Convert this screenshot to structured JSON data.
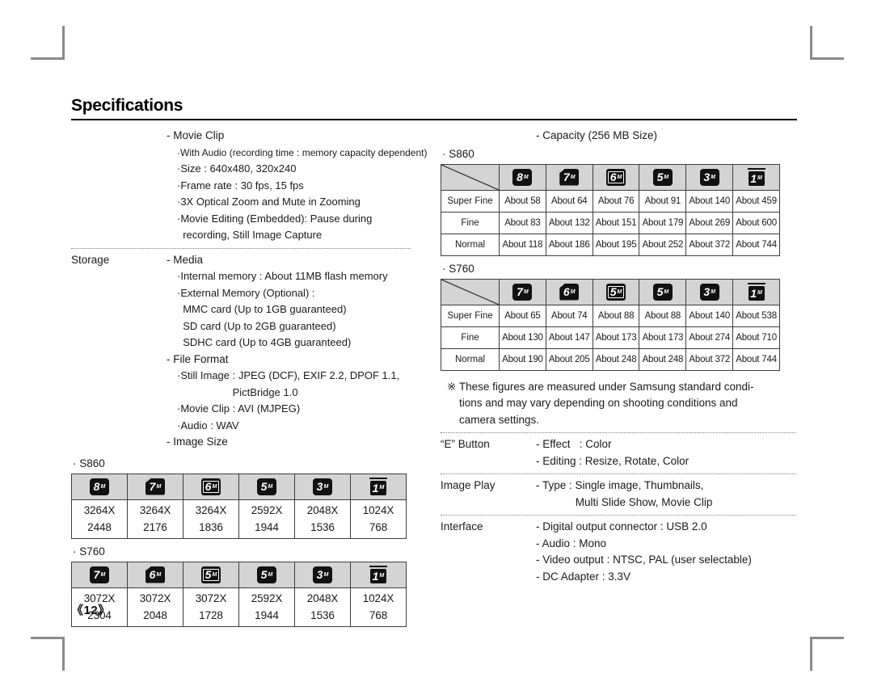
{
  "page": {
    "title": "Specifications",
    "page_number": "《12》"
  },
  "left_column": {
    "movie_clip": {
      "heading": "- Movie Clip",
      "items": [
        "·With Audio (recording time : memory capacity dependent)",
        "·Size : 640x480, 320x240",
        "·Frame rate : 30 fps, 15 fps",
        "·3X Optical Zoom and Mute in Zooming",
        "·Movie Editing (Embedded): Pause during",
        "  recording, Still Image Capture"
      ]
    },
    "storage": {
      "label": "Storage",
      "media_heading": "- Media",
      "media_items": [
        "·Internal memory : About 11MB flash memory",
        "·External Memory (Optional) :",
        "  MMC card (Up to 1GB guaranteed)",
        "  SD card (Up to 2GB guaranteed)",
        "  SDHC card (Up to 4GB guaranteed)"
      ],
      "file_format_heading": "- File Format",
      "file_format_items": [
        "·Still Image : JPEG (DCF), EXIF 2.2, DPOF 1.1,",
        "                   PictBridge 1.0",
        "·Movie Clip : AVI (MJPEG)",
        "·Audio : WAV"
      ],
      "image_size_heading": "- Image Size"
    },
    "image_size_s860": {
      "model": "· S860",
      "icons": [
        {
          "num": "8",
          "m": "M",
          "style": "plain"
        },
        {
          "num": "7",
          "m": "M",
          "style": "cut"
        },
        {
          "num": "6",
          "m": "M",
          "style": "frame"
        },
        {
          "num": "5",
          "m": "M",
          "style": "plain"
        },
        {
          "num": "3",
          "m": "M",
          "style": "plain"
        },
        {
          "num": "1",
          "m": "M",
          "style": "wide"
        }
      ],
      "values_line1": [
        "3264X",
        "3264X",
        "3264X",
        "2592X",
        "2048X",
        "1024X"
      ],
      "values_line2": [
        "2448",
        "2176",
        "1836",
        "1944",
        "1536",
        "768"
      ]
    },
    "image_size_s760": {
      "model": "· S760",
      "icons": [
        {
          "num": "7",
          "m": "M",
          "style": "plain"
        },
        {
          "num": "6",
          "m": "M",
          "style": "cut"
        },
        {
          "num": "5",
          "m": "M",
          "style": "frame"
        },
        {
          "num": "5",
          "m": "M",
          "style": "plain"
        },
        {
          "num": "3",
          "m": "M",
          "style": "plain"
        },
        {
          "num": "1",
          "m": "M",
          "style": "wide"
        }
      ],
      "values_line1": [
        "3072X",
        "3072X",
        "3072X",
        "2592X",
        "2048X",
        "1024X"
      ],
      "values_line2": [
        "2304",
        "2048",
        "1728",
        "1944",
        "1536",
        "768"
      ]
    }
  },
  "right_column": {
    "capacity_heading": "- Capacity (256 MB Size)",
    "capacity_s860": {
      "model": "· S860",
      "icons": [
        {
          "num": "8",
          "m": "M",
          "style": "plain"
        },
        {
          "num": "7",
          "m": "M",
          "style": "cut"
        },
        {
          "num": "6",
          "m": "M",
          "style": "frame"
        },
        {
          "num": "5",
          "m": "M",
          "style": "plain"
        },
        {
          "num": "3",
          "m": "M",
          "style": "plain"
        },
        {
          "num": "1",
          "m": "M",
          "style": "wide"
        }
      ],
      "rows": [
        {
          "label": "Super Fine",
          "cells": [
            "About 58",
            "About 64",
            "About 76",
            "About 91",
            "About 140",
            "About 459"
          ]
        },
        {
          "label": "Fine",
          "cells": [
            "About 83",
            "About 132",
            "About 151",
            "About 179",
            "About 269",
            "About 600"
          ]
        },
        {
          "label": "Normal",
          "cells": [
            "About 118",
            "About 186",
            "About 195",
            "About 252",
            "About 372",
            "About 744"
          ]
        }
      ]
    },
    "capacity_s760": {
      "model": "· S760",
      "icons": [
        {
          "num": "7",
          "m": "M",
          "style": "plain"
        },
        {
          "num": "6",
          "m": "M",
          "style": "cut"
        },
        {
          "num": "5",
          "m": "M",
          "style": "frame"
        },
        {
          "num": "5",
          "m": "M",
          "style": "plain"
        },
        {
          "num": "3",
          "m": "M",
          "style": "plain"
        },
        {
          "num": "1",
          "m": "M",
          "style": "wide"
        }
      ],
      "rows": [
        {
          "label": "Super Fine",
          "cells": [
            "About 65",
            "About 74",
            "About 88",
            "About 88",
            "About 140",
            "About 538"
          ]
        },
        {
          "label": "Fine",
          "cells": [
            "About 130",
            "About 147",
            "About 173",
            "About 173",
            "About 274",
            "About 710"
          ]
        },
        {
          "label": "Normal",
          "cells": [
            "About 190",
            "About 205",
            "About 248",
            "About 248",
            "About 372",
            "About 744"
          ]
        }
      ]
    },
    "note": [
      "※ These figures are measured under Samsung standard condi-",
      "tions and may vary depending on shooting conditions and",
      "camera settings."
    ],
    "e_button": {
      "label": "“E” Button",
      "items": [
        "- Effect   : Color",
        "- Editing : Resize, Rotate, Color"
      ]
    },
    "image_play": {
      "label": "Image Play",
      "items": [
        "- Type : Single image, Thumbnails,",
        "             Multi Slide Show, Movie Clip"
      ]
    },
    "interface": {
      "label": "Interface",
      "items": [
        "- Digital output connector : USB 2.0",
        "- Audio : Mono",
        "- Video output : NTSC, PAL (user selectable)",
        "- DC Adapter : 3.3V"
      ]
    }
  }
}
